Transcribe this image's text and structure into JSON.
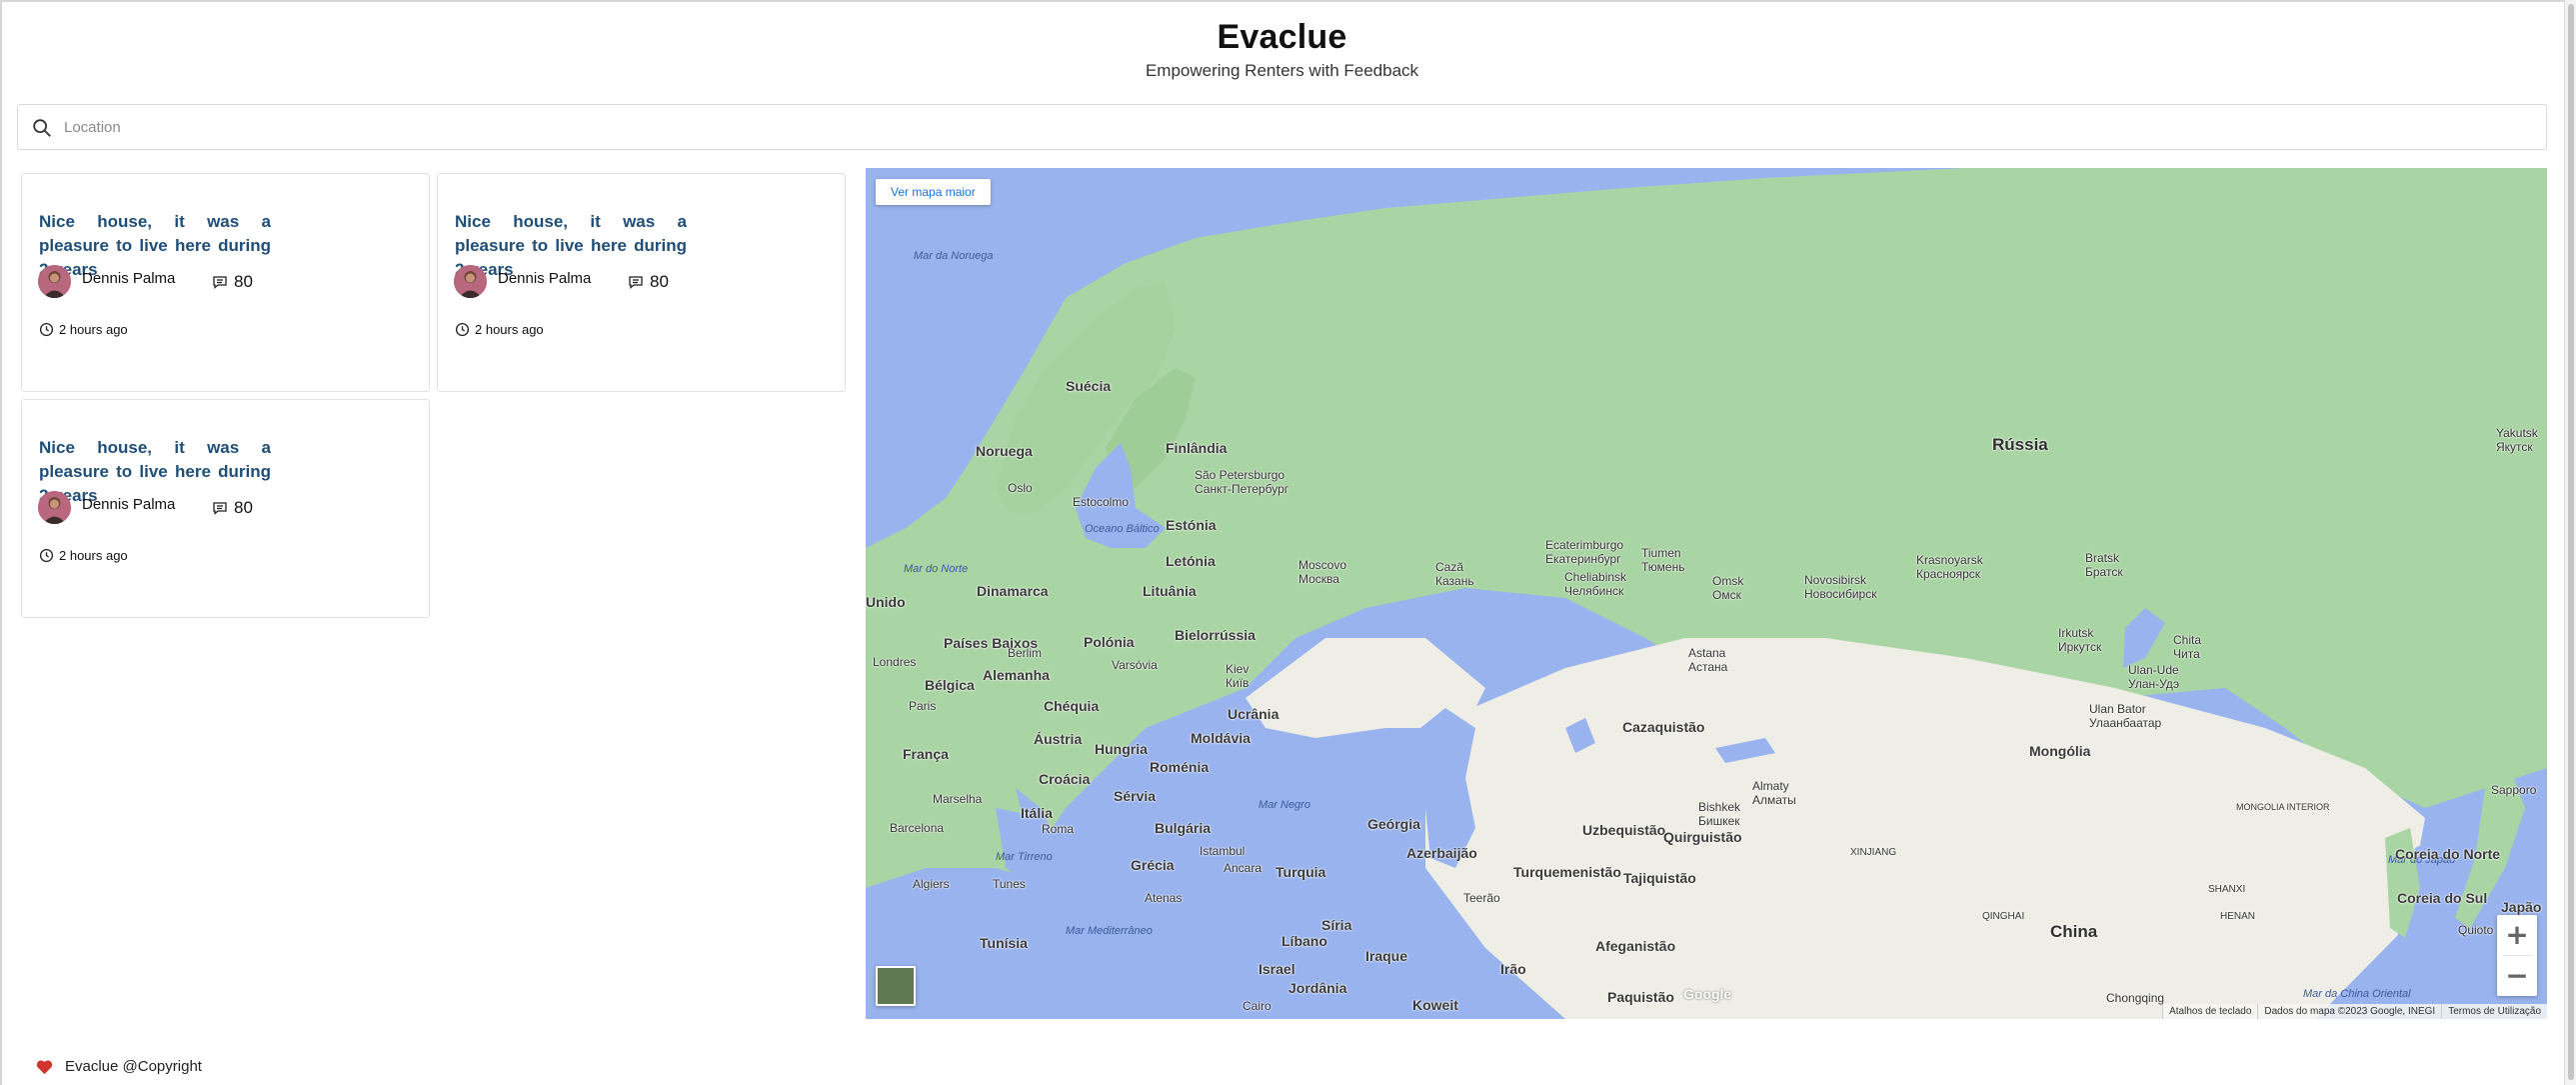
{
  "header": {
    "title": "Evaclue",
    "subtitle": "Empowering Renters with Feedback"
  },
  "search": {
    "placeholder": "Location",
    "icon": "search-icon"
  },
  "reviews": [
    {
      "title": "Nice house, it was a pleasure to live here during 2 years",
      "author": "Dennis Palma",
      "comments": "80",
      "time": "2 hours ago"
    },
    {
      "title": "Nice house, it was a pleasure to live here during 2 years",
      "author": "Dennis Palma",
      "comments": "80",
      "time": "2 hours ago"
    },
    {
      "title": "Nice house, it was a pleasure to live here during 2 years",
      "author": "Dennis Palma",
      "comments": "80",
      "time": "2 hours ago"
    }
  ],
  "map": {
    "larger_map_button": "Ver mapa maior",
    "zoom_in": "+",
    "zoom_out": "−",
    "watermark": "Google",
    "footer": [
      "Atalhos de teclado",
      "Dados do mapa ©2023 Google, INEGI",
      "Termos de Utilização"
    ],
    "labels": {
      "russia": "Rússia",
      "mongolia": "Mongólia",
      "china": "China",
      "kazakhstan": "Cazaquistão",
      "sweden": "Suécia",
      "norway": "Noruega",
      "finland": "Finlândia",
      "estonia": "Estónia",
      "latvia": "Letónia",
      "lithuania": "Lituânia",
      "belarus": "Bielorrússia",
      "poland": "Polónia",
      "ukraine": "Ucrânia",
      "moldova": "Moldávia",
      "romania": "Roménia",
      "hungary": "Hungria",
      "czechia": "Chéquia",
      "austria": "Áustria",
      "germany": "Alemanha",
      "netherlands": "Países Baixos",
      "belgium": "Bélgica",
      "france": "França",
      "croatia": "Croácia",
      "serbia": "Sérvia",
      "bulgaria": "Bulgária",
      "italy": "Itália",
      "greece": "Grécia",
      "turkey": "Turquia",
      "georgia": "Geórgia",
      "azerbaijan": "Azerbaijão",
      "turkmenistan": "Turquemenistão",
      "uzbekistan": "Uzbequistão",
      "kyrgyzstan": "Quirguistão",
      "tajikistan": "Tajiquistão",
      "afghanistan": "Afeganistão",
      "iran": "Irão",
      "iraq": "Iraque",
      "syria": "Síria",
      "lebanon": "Líbano",
      "israel": "Israel",
      "jordan": "Jordânia",
      "kuwait": "Koweit",
      "pakistan": "Paquistão",
      "tunisia": "Tunísia",
      "denmark": "Dinamarca",
      "uk": "Unido",
      "north_korea": "Coreia do Norte",
      "south_korea": "Coreia do Sul",
      "japan": "Japão",
      "sea_norway": "Mar da Noruega",
      "sea_north": "Mar do Norte",
      "sea_baltic": "Oceano Báltico",
      "sea_black": "Mar Negro",
      "sea_tyrrhenian": "Mar Tirreno",
      "sea_med": "Mar Mediterrâneo",
      "sea_japan": "Mar do Japão",
      "sea_east_china": "Mar da China Oriental",
      "city_stpetersburg": "São Petersburgo\nСанкт-Петербург",
      "city_moscow": "Moscovo\nМосква",
      "city_kazan": "Cazã\nКазань",
      "city_ekaterinburg": "Ecaterimburgo\nЕкатеринбург",
      "city_tyumen": "Tiumen\nТюмень",
      "city_chelyabinsk": "Cheliabinsk\nЧелябинск",
      "city_omsk": "Omsk\nОмск",
      "city_novosibirsk": "Novosibirsk\nНовосибирск",
      "city_krasnoyarsk": "Krasnoyarsk\nКрасноярск",
      "city_bratsk": "Bratsk\nБратск",
      "city_irkutsk": "Irkutsk\nИркутск",
      "city_chita": "Chita\nЧита",
      "city_ulanude": "Ulan-Ude\nУлан-Удэ",
      "city_ulaanbaatar": "Ulan Bator\nУлаанбаатар",
      "city_yakutsk": "Yakutsk\nЯкутск",
      "city_astana": "Astana\nАстана",
      "city_almaty": "Almaty\nАлматы",
      "city_bishkek": "Bishkek\nБишкек",
      "city_oslo": "Oslo",
      "city_stockholm": "Estocolmo",
      "city_london": "Londres",
      "city_paris": "Paris",
      "city_berlin": "Berlim",
      "city_warsaw": "Varsóvia",
      "city_kyiv": "Kiev\nКиїв",
      "city_marseille": "Marselha",
      "city_barcelona": "Barcelona",
      "city_rome": "Roma",
      "city_istanbul": "Istambul",
      "city_ankara": "Ancara",
      "city_athens": "Atenas",
      "city_algiers": "Algiers",
      "city_tunis": "Tunes",
      "city_cairo": "Cairo",
      "city_tehran": "Teerão",
      "city_sapporo": "Sapporo",
      "city_chongqing": "Chongqing",
      "city_xinjiang": "XINJIANG",
      "city_qinghai": "QINGHAI",
      "city_inner_mongolia": "MONGOLIA INTERIOR",
      "city_henan": "HENAN",
      "city_shanxi": "SHANXI",
      "city_kyoto": "Quioto"
    }
  },
  "footer": {
    "text": "Evaclue @Copyright",
    "icon": "heart-icon"
  },
  "colors": {
    "title_blue": "#1f4e79",
    "heart": "#d0342c",
    "map_water": "#99b3ee",
    "map_forest": "#9ecf9b",
    "map_land": "#f0efe9"
  }
}
